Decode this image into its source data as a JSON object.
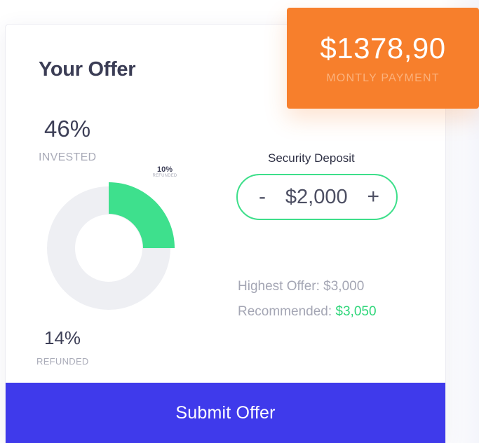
{
  "offer_card": {
    "title": "Your Offer",
    "invested": {
      "percent": "46%",
      "label": "INVESTED"
    },
    "refunded": {
      "percent": "14%",
      "label": "REFUNDED"
    },
    "chart_callout": {
      "percent": "10%",
      "label": "REFUNDED"
    },
    "donut": {
      "highlight_fraction": 0.25,
      "colors": {
        "track": "#eeeff3",
        "highlight": "#3ee08d"
      }
    },
    "security_deposit": {
      "title": "Security Deposit",
      "value": "$2,000",
      "decrement_label": "-",
      "increment_label": "+"
    },
    "highest_offer": {
      "label": "Highest Offer:",
      "value": "$3,000"
    },
    "recommended": {
      "label": "Recommended:",
      "value": "$3,050"
    },
    "submit_label": "Submit Offer"
  },
  "payment_badge": {
    "amount": "$1378,90",
    "caption": "MONTLY PAYMENT"
  },
  "colors": {
    "accent_blue": "#3f3aeb",
    "accent_orange": "#f77f2c",
    "accent_green": "#3ddf8a",
    "text_dark": "#3b3d55",
    "text_muted": "#a9abb8"
  }
}
